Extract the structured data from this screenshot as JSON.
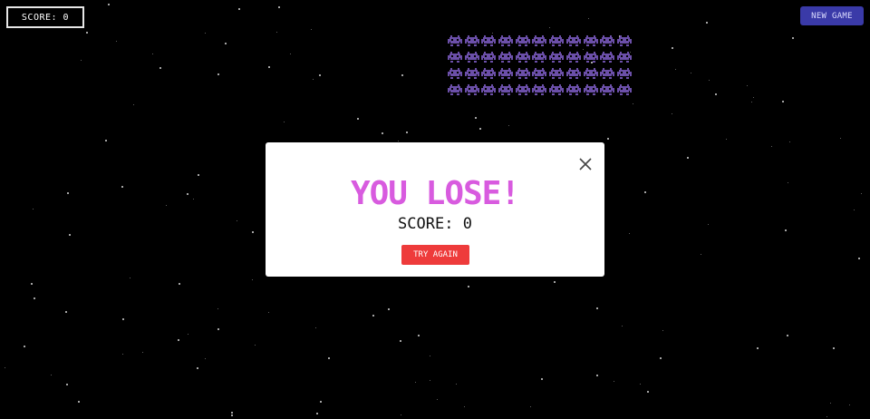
{
  "hud": {
    "score_label": "SCORE: 0",
    "new_game_label": "NEW GAME"
  },
  "invaders": {
    "rows": 4,
    "cols": 11,
    "color": "#6b4fa8",
    "icon": "invader-icon"
  },
  "modal": {
    "title": "YOU LOSE!",
    "score_label": "SCORE: 0",
    "try_again_label": "TRY AGAIN",
    "close_icon": "close-icon",
    "title_color": "#d85bdf",
    "button_color": "#ee3b3b"
  },
  "colors": {
    "background": "#000000",
    "accent": "#3a3aa8"
  }
}
